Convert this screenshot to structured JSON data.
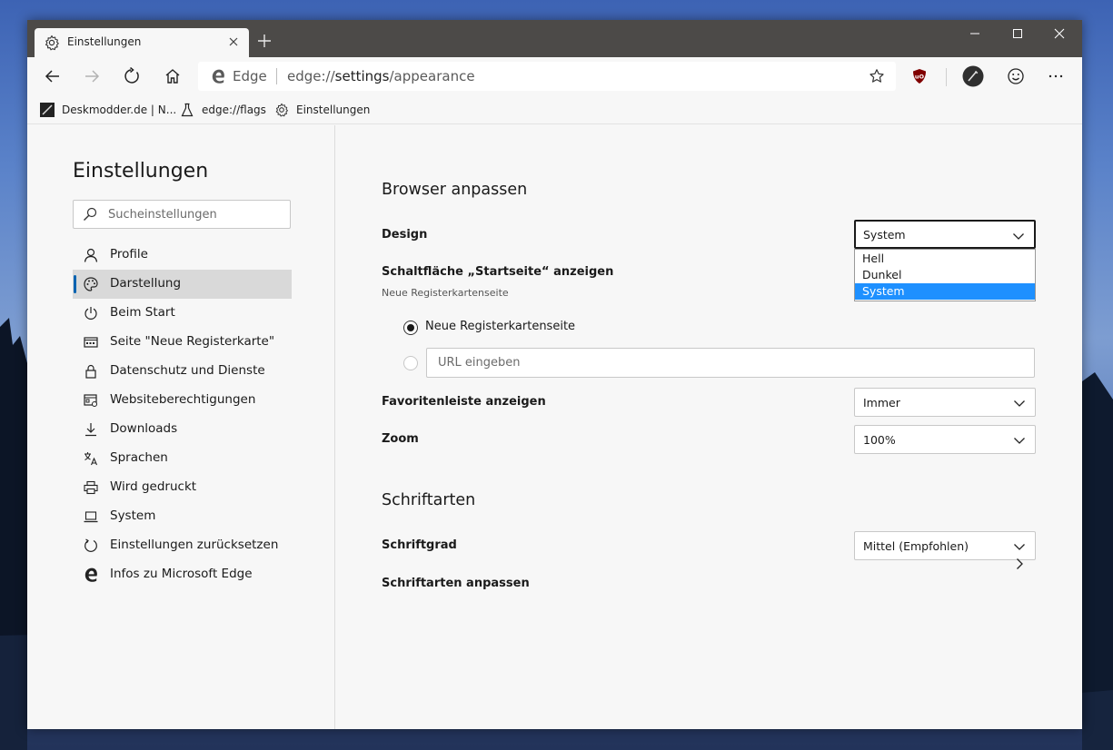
{
  "window": {
    "tab_title": "Einstellungen",
    "tab_icon": "gear-icon"
  },
  "toolbar": {
    "address_label": "Edge",
    "url_scheme": "edge://",
    "url_host": "settings",
    "url_path": "/appearance"
  },
  "favorites": [
    {
      "label": "Deskmodder.de | N...",
      "icon": "deskmodder-icon"
    },
    {
      "label": "edge://flags",
      "icon": "flask-icon"
    },
    {
      "label": "Einstellungen",
      "icon": "gear-icon"
    }
  ],
  "sidebar": {
    "title": "Einstellungen",
    "search_placeholder": "Sucheinstellungen",
    "items": [
      {
        "label": "Profile",
        "icon": "person-icon",
        "active": false
      },
      {
        "label": "Darstellung",
        "icon": "palette-icon",
        "active": true
      },
      {
        "label": "Beim Start",
        "icon": "power-icon",
        "active": false
      },
      {
        "label": "Seite \"Neue Registerkarte\"",
        "icon": "newtab-page-icon",
        "active": false
      },
      {
        "label": "Datenschutz und Dienste",
        "icon": "lock-icon",
        "active": false
      },
      {
        "label": "Websiteberechtigungen",
        "icon": "site-permissions-icon",
        "active": false
      },
      {
        "label": "Downloads",
        "icon": "download-icon",
        "active": false
      },
      {
        "label": "Sprachen",
        "icon": "language-icon",
        "active": false
      },
      {
        "label": "Wird gedruckt",
        "icon": "printer-icon",
        "active": false
      },
      {
        "label": "System",
        "icon": "laptop-icon",
        "active": false
      },
      {
        "label": "Einstellungen zurücksetzen",
        "icon": "reset-icon",
        "active": false
      },
      {
        "label": "Infos zu Microsoft Edge",
        "icon": "edge-logo-icon",
        "active": false
      }
    ]
  },
  "main": {
    "section_browser": "Browser anpassen",
    "design": {
      "label": "Design",
      "value": "System",
      "options": [
        "Hell",
        "Dunkel",
        "System"
      ],
      "selected_index": 2
    },
    "home_button": {
      "label": "Schaltfläche „Startseite“ anzeigen",
      "sublabel": "Neue Registerkartenseite",
      "radio_newtab": "Neue Registerkartenseite",
      "url_placeholder": "URL eingeben"
    },
    "favorites_bar": {
      "label": "Favoritenleiste anzeigen",
      "value": "Immer"
    },
    "zoom": {
      "label": "Zoom",
      "value": "100%"
    },
    "section_fonts": "Schriftarten",
    "font_size": {
      "label": "Schriftgrad",
      "value": "Mittel (Empfohlen)"
    },
    "customize_fonts": {
      "label": "Schriftarten anpassen"
    }
  },
  "colors": {
    "accent": "#0063b1",
    "selected_option": "#1e90ff",
    "titlebar": "#4c4a48"
  }
}
